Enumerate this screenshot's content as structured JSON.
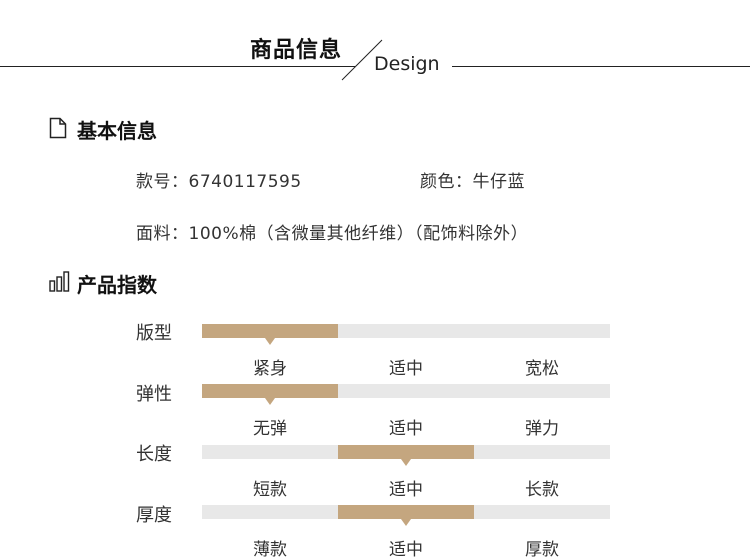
{
  "header": {
    "title": "商品信息",
    "subtitle": "Design"
  },
  "basic_info": {
    "title": "基本信息",
    "icon": "document-icon",
    "style_no": "款号：6740117595",
    "color": "颜色：牛仔蓝",
    "material": "面料：100%棉（含微量其他纤维）（配饰料除外）"
  },
  "product_index": {
    "title": "产品指数",
    "icon": "bar-chart-icon",
    "accent_color": "#c4a67f",
    "track_color": "#e8e8e8",
    "attributes": [
      {
        "label": "版型",
        "options": [
          "紧身",
          "适中",
          "宽松"
        ],
        "selected_index": 0
      },
      {
        "label": "弹性",
        "options": [
          "无弹",
          "适中",
          "弹力"
        ],
        "selected_index": 0
      },
      {
        "label": "长度",
        "options": [
          "短款",
          "适中",
          "长款"
        ],
        "selected_index": 1
      },
      {
        "label": "厚度",
        "options": [
          "薄款",
          "适中",
          "厚款"
        ],
        "selected_index": 1
      }
    ]
  }
}
